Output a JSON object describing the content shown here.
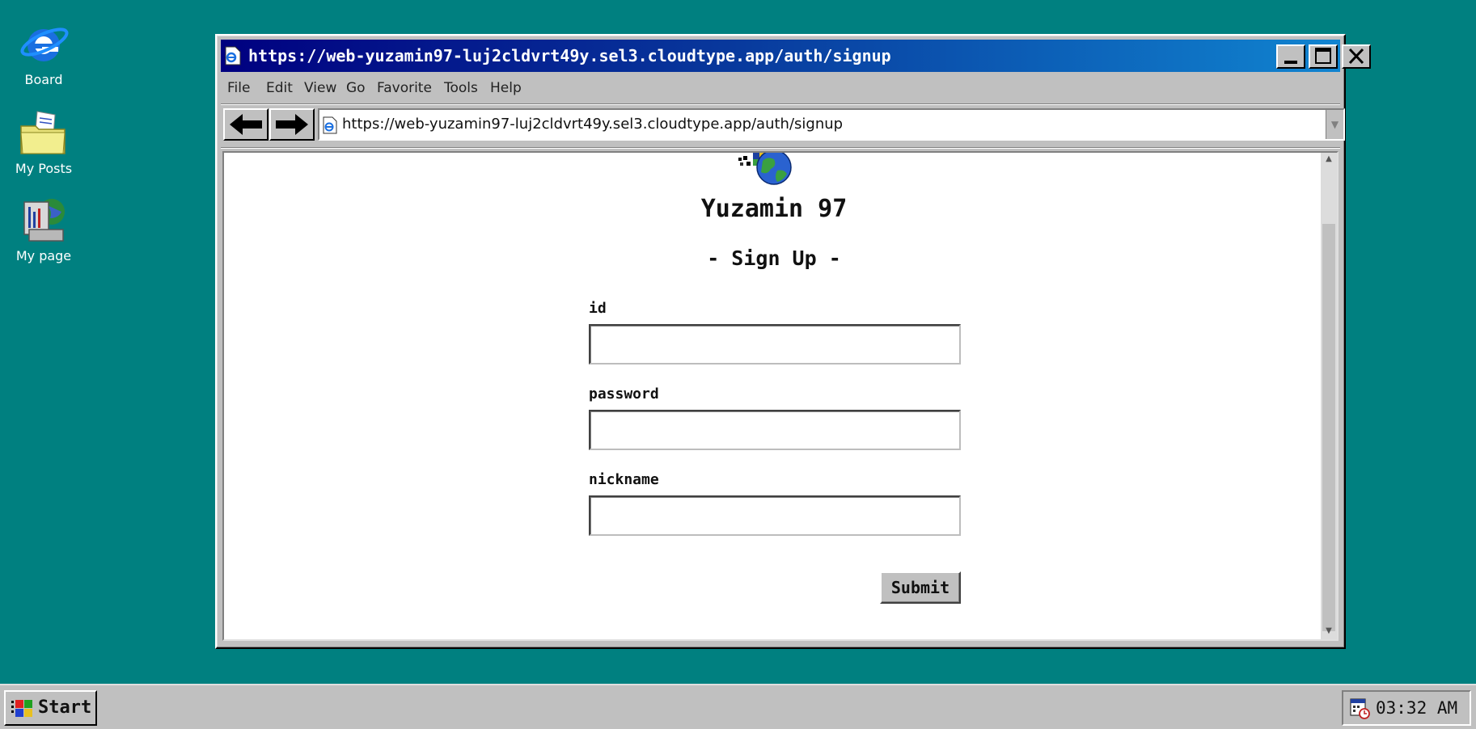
{
  "desktop": {
    "icons": [
      {
        "label": "Board",
        "icon": "internet-explorer-icon"
      },
      {
        "label": "My Posts",
        "icon": "folder-icon"
      },
      {
        "label": "My page",
        "icon": "computer-icon"
      }
    ]
  },
  "window": {
    "title": "https://web-yuzamin97-luj2cldvrt49y.sel3.cloudtype.app/auth/signup",
    "menu": [
      "File",
      "Edit",
      "View",
      "Go",
      "Favorite",
      "Tools",
      "Help"
    ],
    "address": "https://web-yuzamin97-luj2cldvrt49y.sel3.cloudtype.app/auth/signup"
  },
  "page": {
    "app_title": "Yuzamin 97",
    "heading": "- Sign Up -",
    "fields": [
      {
        "label": "id",
        "value": "",
        "placeholder": ""
      },
      {
        "label": "password",
        "value": "",
        "placeholder": ""
      },
      {
        "label": "nickname",
        "value": "",
        "placeholder": ""
      }
    ],
    "submit_label": "Submit"
  },
  "taskbar": {
    "start_label": "Start",
    "clock": "03:32 AM"
  },
  "colors": {
    "desktop": "#008080",
    "title_start": "#000080",
    "title_end": "#1084d0",
    "chrome": "#c0c0c0"
  }
}
